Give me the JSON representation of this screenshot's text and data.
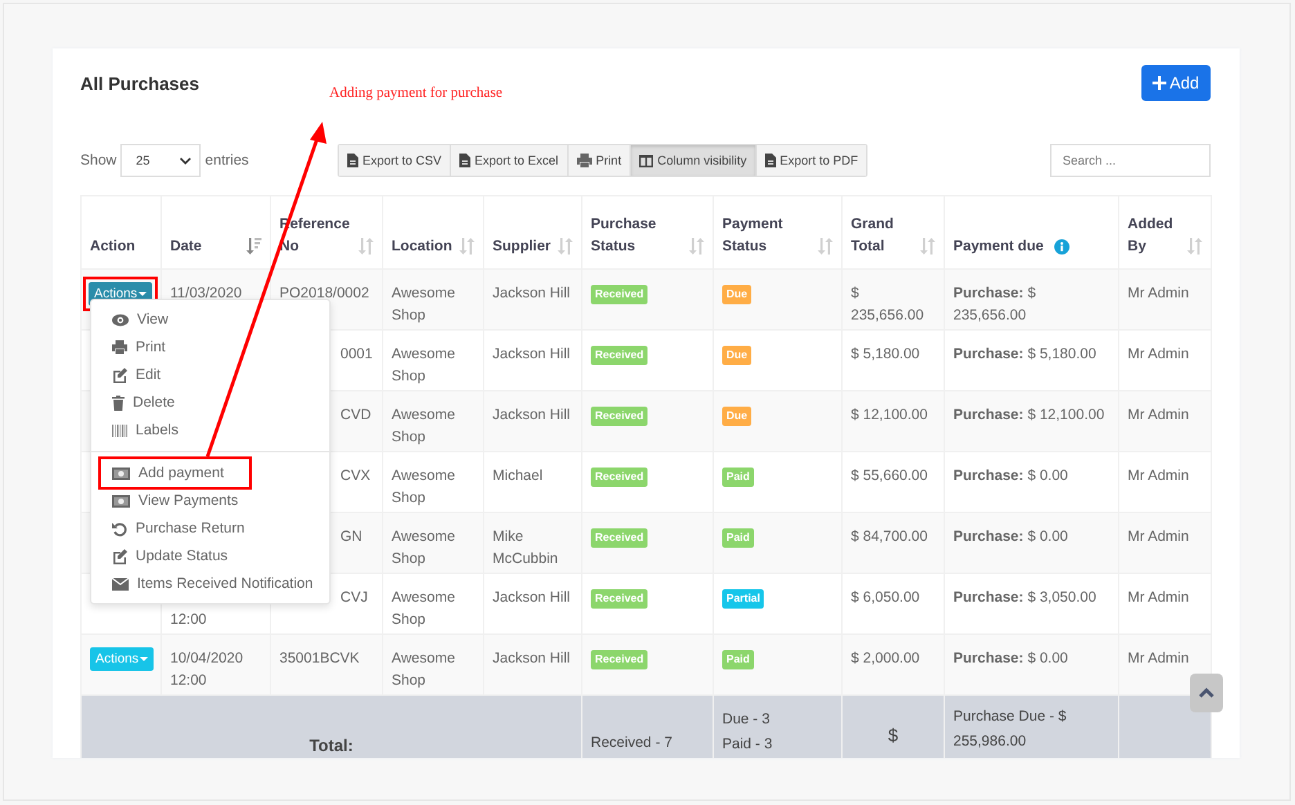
{
  "title": "All Purchases",
  "add_button": "Add",
  "annotation": "Adding payment for purchase",
  "length": {
    "prefix": "Show",
    "value": "25",
    "suffix": "entries"
  },
  "toolbar": [
    {
      "label": "Export to CSV",
      "selected": false
    },
    {
      "label": "Export to Excel",
      "selected": false
    },
    {
      "label": "Print",
      "selected": false
    },
    {
      "label": "Column visibility",
      "selected": true
    },
    {
      "label": "Export to PDF",
      "selected": false
    }
  ],
  "search": {
    "placeholder": "Search ..."
  },
  "columns": [
    {
      "label": "Action",
      "kind": "plain"
    },
    {
      "label": "Date",
      "kind": "sorted"
    },
    {
      "label": "Reference No",
      "kind": "sortable"
    },
    {
      "label": "Location",
      "kind": "sortable"
    },
    {
      "label": "Supplier",
      "kind": "sortable"
    },
    {
      "label": "Purchase Status",
      "kind": "sortable"
    },
    {
      "label": "Payment Status",
      "kind": "sortable"
    },
    {
      "label": "Grand Total",
      "kind": "sortable"
    },
    {
      "label": "Payment due",
      "kind": "info"
    },
    {
      "label": "Added By",
      "kind": "sortable"
    }
  ],
  "rows": [
    {
      "action": {
        "label": "Actions",
        "expanded": true,
        "highlighted": true
      },
      "date": "11/03/2020",
      "reference": "PO2018/0002",
      "location": "Awesome Shop",
      "supplier": "Jackson Hill",
      "purchase_status": {
        "label": "Received",
        "color": "#8cd66c"
      },
      "payment_status": {
        "label": "Due",
        "color": "#ffad46"
      },
      "grand_total": "$ 235,656.00",
      "payment_due": "**Purchase:** $ 235,656.00",
      "added_by": "Mr Admin"
    },
    {
      "reference": "0001",
      "location": "Awesome Shop",
      "supplier": "Jackson Hill",
      "purchase_status": {
        "label": "Received",
        "color": "#8cd66c"
      },
      "payment_status": {
        "label": "Due",
        "color": "#ffad46"
      },
      "grand_total": "$ 5,180.00",
      "payment_due": "**Purchase:** $ 5,180.00",
      "added_by": "Mr Admin"
    },
    {
      "reference": "CVD",
      "location": "Awesome Shop",
      "supplier": "Jackson Hill",
      "purchase_status": {
        "label": "Received",
        "color": "#8cd66c"
      },
      "payment_status": {
        "label": "Due",
        "color": "#ffad46"
      },
      "grand_total": "$ 12,100.00",
      "payment_due": "**Purchase:** $ 12,100.00",
      "added_by": "Mr Admin"
    },
    {
      "reference": "CVX",
      "location": "Awesome Shop",
      "supplier": "Michael",
      "purchase_status": {
        "label": "Received",
        "color": "#8cd66c"
      },
      "payment_status": {
        "label": "Paid",
        "color": "#8cd66c"
      },
      "grand_total": "$ 55,660.00",
      "payment_due": "**Purchase:** $ 0.00",
      "added_by": "Mr Admin"
    },
    {
      "reference": "GN",
      "location": "Awesome Shop",
      "supplier": "Mike McCubbin",
      "purchase_status": {
        "label": "Received",
        "color": "#8cd66c"
      },
      "payment_status": {
        "label": "Paid",
        "color": "#8cd66c"
      },
      "grand_total": "$ 84,700.00",
      "payment_due": "**Purchase:** $ 0.00",
      "added_by": "Mr Admin"
    },
    {
      "date_tail": "12:00",
      "reference": "CVJ",
      "location": "Awesome Shop",
      "supplier": "Jackson Hill",
      "purchase_status": {
        "label": "Received",
        "color": "#8cd66c"
      },
      "payment_status": {
        "label": "Partial",
        "color": "#16c6ea"
      },
      "grand_total": "$ 6,050.00",
      "payment_due": "**Purchase:** $ 3,050.00",
      "added_by": "Mr Admin"
    },
    {
      "action": {
        "label": "Actions",
        "expanded": false,
        "highlighted": false
      },
      "date": "10/04/2020 12:00",
      "reference": "35001BCVK",
      "location": "Awesome Shop",
      "supplier": "Jackson Hill",
      "purchase_status": {
        "label": "Received",
        "color": "#8cd66c"
      },
      "payment_status": {
        "label": "Paid",
        "color": "#8cd66c"
      },
      "grand_total": "$ 2,000.00",
      "payment_due": "**Purchase:** $ 0.00",
      "added_by": "Mr Admin"
    }
  ],
  "totals": {
    "label": "Total:",
    "purchase_status": [
      "Received - 7"
    ],
    "payment_status": [
      "Due - 3",
      "Paid - 3"
    ],
    "grand_total": "$",
    "payment_due": "Purchase Due - $ 255,986.00"
  },
  "menu": [
    [
      {
        "label": "View",
        "highlighted": false
      },
      {
        "label": "Print",
        "highlighted": false
      },
      {
        "label": "Edit",
        "highlighted": false
      },
      {
        "label": "Delete",
        "highlighted": false
      },
      {
        "label": "Labels",
        "highlighted": false
      }
    ],
    [
      {
        "label": "Add payment",
        "highlighted": true
      },
      {
        "label": "View Payments",
        "highlighted": false
      },
      {
        "label": "Purchase Return",
        "highlighted": false
      },
      {
        "label": "Update Status",
        "highlighted": false
      },
      {
        "label": "Items Received Notification",
        "highlighted": false
      }
    ]
  ]
}
